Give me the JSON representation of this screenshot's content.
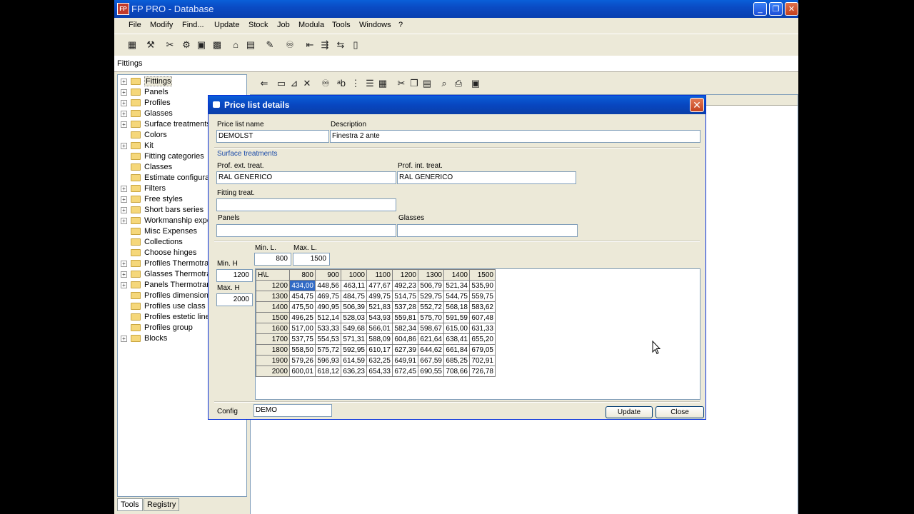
{
  "window": {
    "title": "FP PRO - Database"
  },
  "menu": [
    "File",
    "Modify",
    "Find...",
    "Update",
    "Stock",
    "Job",
    "Modula",
    "Tools",
    "Windows",
    "?"
  ],
  "path": "Fittings",
  "tree": [
    {
      "label": "Fittings",
      "expandable": true,
      "selected": true
    },
    {
      "label": "Panels",
      "expandable": true
    },
    {
      "label": "Profiles",
      "expandable": true
    },
    {
      "label": "Glasses",
      "expandable": true
    },
    {
      "label": "Surface treatments",
      "expandable": true
    },
    {
      "label": "Colors",
      "expandable": false
    },
    {
      "label": "Kit",
      "expandable": true
    },
    {
      "label": "Fitting categories",
      "expandable": false
    },
    {
      "label": "Classes",
      "expandable": false
    },
    {
      "label": "Estimate configurati",
      "expandable": false
    },
    {
      "label": "Filters",
      "expandable": true
    },
    {
      "label": "Free styles",
      "expandable": true
    },
    {
      "label": "Short bars series",
      "expandable": true
    },
    {
      "label": "Workmanship exper",
      "expandable": true
    },
    {
      "label": "Misc Expenses",
      "expandable": false
    },
    {
      "label": "Collections",
      "expandable": false
    },
    {
      "label": "Choose hinges",
      "expandable": false
    },
    {
      "label": "Profiles Thermotran",
      "expandable": true
    },
    {
      "label": "Glasses Thermotran",
      "expandable": true
    },
    {
      "label": "Panels Thermotrans",
      "expandable": true
    },
    {
      "label": "Profiles dimension",
      "expandable": false
    },
    {
      "label": "Profiles use class",
      "expandable": false
    },
    {
      "label": "Profiles estetic line",
      "expandable": false
    },
    {
      "label": "Profiles group",
      "expandable": false
    },
    {
      "label": "Blocks",
      "expandable": true
    }
  ],
  "tabs": [
    "Tools",
    "Registry"
  ],
  "dialog": {
    "title": "Price list details",
    "price_list_name_label": "Price list name",
    "price_list_name": "DEMOLST",
    "description_label": "Description",
    "description": "Finestra 2 ante",
    "surface_treatments_label": "Surface treatments",
    "prof_ext_label": "Prof. ext. treat.",
    "prof_ext": "RAL GENERICO",
    "prof_int_label": "Prof. int. treat.",
    "prof_int": "RAL GENERICO",
    "fitting_treat_label": "Fitting treat.",
    "fitting_treat": "",
    "panels_label": "Panels",
    "panels": "",
    "glasses_label": "Glasses",
    "glasses": "",
    "min_l_label": "Min. L.",
    "min_l": "800",
    "max_l_label": "Max. L.",
    "max_l": "1500",
    "min_h_label": "Min. H",
    "min_h": "1200",
    "max_h_label": "Max. H",
    "max_h": "2000",
    "config_label": "Config",
    "config": "DEMO",
    "update_label": "Update",
    "close_label": "Close"
  },
  "price_table": {
    "corner": "H\\L",
    "widths": [
      "800",
      "900",
      "1000",
      "1100",
      "1200",
      "1300",
      "1400",
      "1500"
    ],
    "rows": [
      {
        "h": "1200",
        "values": [
          "434,00",
          "448,56",
          "463,11",
          "477,67",
          "492,23",
          "506,79",
          "521,34",
          "535,90"
        ]
      },
      {
        "h": "1300",
        "values": [
          "454,75",
          "469,75",
          "484,75",
          "499,75",
          "514,75",
          "529,75",
          "544,75",
          "559,75"
        ]
      },
      {
        "h": "1400",
        "values": [
          "475,50",
          "490,95",
          "506,39",
          "521,83",
          "537,28",
          "552,72",
          "568,18",
          "583,62"
        ]
      },
      {
        "h": "1500",
        "values": [
          "496,25",
          "512,14",
          "528,03",
          "543,93",
          "559,81",
          "575,70",
          "591,59",
          "607,48"
        ]
      },
      {
        "h": "1600",
        "values": [
          "517,00",
          "533,33",
          "549,68",
          "566,01",
          "582,34",
          "598,67",
          "615,00",
          "631,33"
        ]
      },
      {
        "h": "1700",
        "values": [
          "537,75",
          "554,53",
          "571,31",
          "588,09",
          "604,86",
          "621,64",
          "638,41",
          "655,20"
        ]
      },
      {
        "h": "1800",
        "values": [
          "558,50",
          "575,72",
          "592,95",
          "610,17",
          "627,39",
          "644,62",
          "661,84",
          "679,05"
        ]
      },
      {
        "h": "1900",
        "values": [
          "579,26",
          "596,93",
          "614,59",
          "632,25",
          "649,91",
          "667,59",
          "685,25",
          "702,91"
        ]
      },
      {
        "h": "2000",
        "values": [
          "600,01",
          "618,12",
          "636,23",
          "654,33",
          "672,45",
          "690,55",
          "708,66",
          "726,78"
        ]
      }
    ]
  }
}
